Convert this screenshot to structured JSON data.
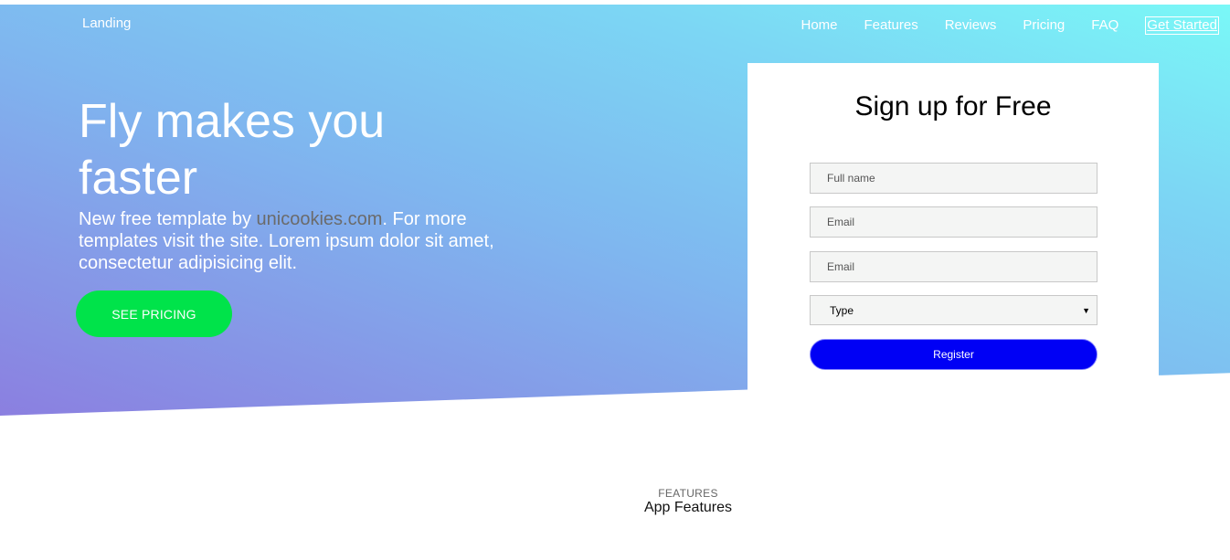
{
  "nav": {
    "brand": "Landing",
    "items": [
      "Home",
      "Features",
      "Reviews",
      "Pricing",
      "FAQ"
    ],
    "cta": "Get Started"
  },
  "hero": {
    "title": "Fly makes you faster",
    "text_before": "New free template by ",
    "link": "unicookies.com",
    "text_after": ". For more templates visit the site. Lorem ipsum dolor sit amet, consectetur adipisicing elit.",
    "button": "SEE PRICING"
  },
  "signup": {
    "title": "Sign up for Free",
    "fullname_placeholder": "Full name",
    "email_placeholder": "Email",
    "email2_placeholder": "Email",
    "type_value": "Type",
    "register": "Register"
  },
  "features": {
    "eyebrow": "FEATURES",
    "title": "App Features"
  },
  "colors": {
    "gradient_start": "#8b7fe0",
    "gradient_end": "#7af8f7",
    "pricing_button": "#00e34a",
    "register_button": "#0000f5"
  }
}
